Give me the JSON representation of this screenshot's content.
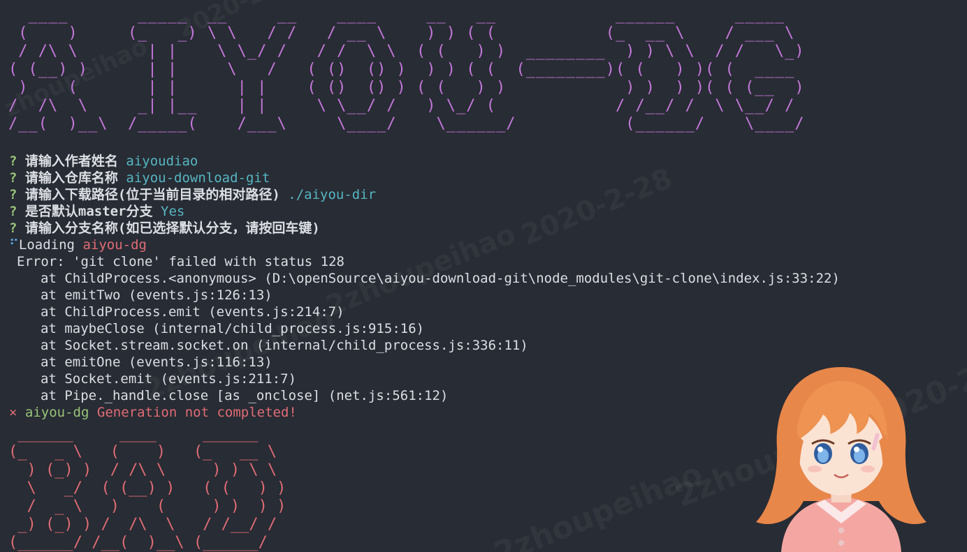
{
  "banner_ascii": "  ____       _____  __     __    ____     __   __            ______      _____\n (    )     (_   _) \\ \\   / /   / __ \\    ) ) ( (           (_  __ \\    / ___ \\\n / /\\ \\       | |    \\ \\_/ /   / /  \\ \\  ( (   ) )  ________  ) ) \\ \\  / /   \\_)\n( (__) )      | |     \\   /   ( ()  () )  ) ) ( (  (________)( (   ) )( (  ____\n )    (       | |      | |    ( ()  () ) ( (   ) )            ) )  ) )( ( (__  )\n/  /\\  \\     _| |__    | |     \\ \\__/ /   ) \\_/ (            / /__/ /  \\ \\__/ /\n/__(  )__\\  /_____(    /___\\     \\____/    \\______/           (______/    \\____/",
  "prompts": [
    {
      "mark": "?",
      "question": "请输入作者姓名",
      "answer": "aiyoudiao"
    },
    {
      "mark": "?",
      "question": "请输入仓库名称",
      "answer": "aiyou-download-git"
    },
    {
      "mark": "?",
      "question": "请输入下载路径(位于当前目录的相对路径)",
      "answer": "./aiyou-dir"
    },
    {
      "mark": "?",
      "question": "是否默认master分支",
      "answer": "Yes"
    },
    {
      "mark": "?",
      "question": "请输入分支名称(如已选择默认分支，请按回车键)",
      "answer": ""
    }
  ],
  "loading": {
    "spinner": "⠋",
    "label": "Loading",
    "name": "aiyou-dg"
  },
  "error": {
    "message": "Error: 'git clone' failed with status 128",
    "stack": [
      "at ChildProcess.<anonymous> (D:\\openSource\\aiyou-download-git\\node_modules\\git-clone\\index.js:33:22)",
      "at emitTwo (events.js:126:13)",
      "at ChildProcess.emit (events.js:214:7)",
      "at maybeClose (internal/child_process.js:915:16)",
      "at Socket.stream.socket.on (internal/child_process.js:336:11)",
      "at emitOne (events.js:116:13)",
      "at Socket.emit (events.js:211:7)",
      "at Pipe._handle.close [as _onclose] (net.js:561:12)"
    ]
  },
  "failure": {
    "mark": "×",
    "cli_name": "aiyou-dg",
    "message": "Generation not completed!"
  },
  "bad_ascii": " ______     ____     ______\n(_   _ \\   (    )   (_   __ \\\n  ) (_) )  / /\\ \\     ) ) \\ \\\n  \\   _/  ( (__) )   ( (   ) )\n  /  _ \\   )    (     ) )  ) )\n _) (_) ) /  /\\  \\   / /__/ /\n(______/ /__(  )__\\ (______/",
  "watermark": {
    "date": "2020-2-28",
    "handle": "2zhoupeihao",
    "date_partial": "2020-2-",
    "date_fragment": "2020-2",
    "handle_fragment": "zhoupeihao"
  },
  "colors": {
    "background": "#282c34",
    "banner": "#c678dd",
    "prompt_mark": "#98c379",
    "answer": "#56b6c2",
    "error_accent": "#e06c75",
    "text": "#dcdfe4"
  }
}
